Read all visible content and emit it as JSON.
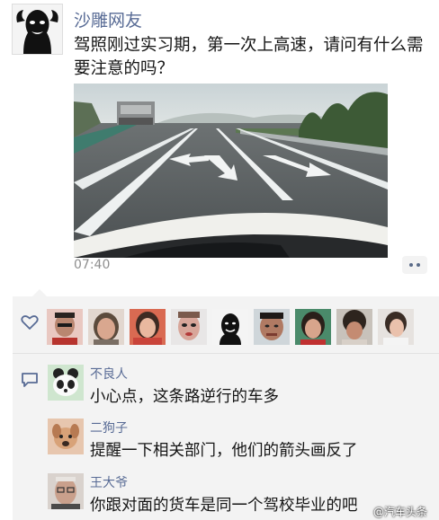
{
  "post": {
    "username": "沙雕网友",
    "text": "驾照刚过实习期，第一次上高速，请问有什么需要注意的吗？",
    "time": "07:40"
  },
  "likes": {
    "icon": "heart-outline-icon",
    "avatar_count": 9
  },
  "comments": [
    {
      "name": "不良人",
      "text": "小心点，这条路逆行的车多"
    },
    {
      "name": "二狗子",
      "text": "提醒一下相关部门，他们的箭头画反了"
    },
    {
      "name": "王大爷",
      "text": "你跟对面的货车是同一个驾校毕业的吧"
    }
  ],
  "watermark": "@汽车头条"
}
